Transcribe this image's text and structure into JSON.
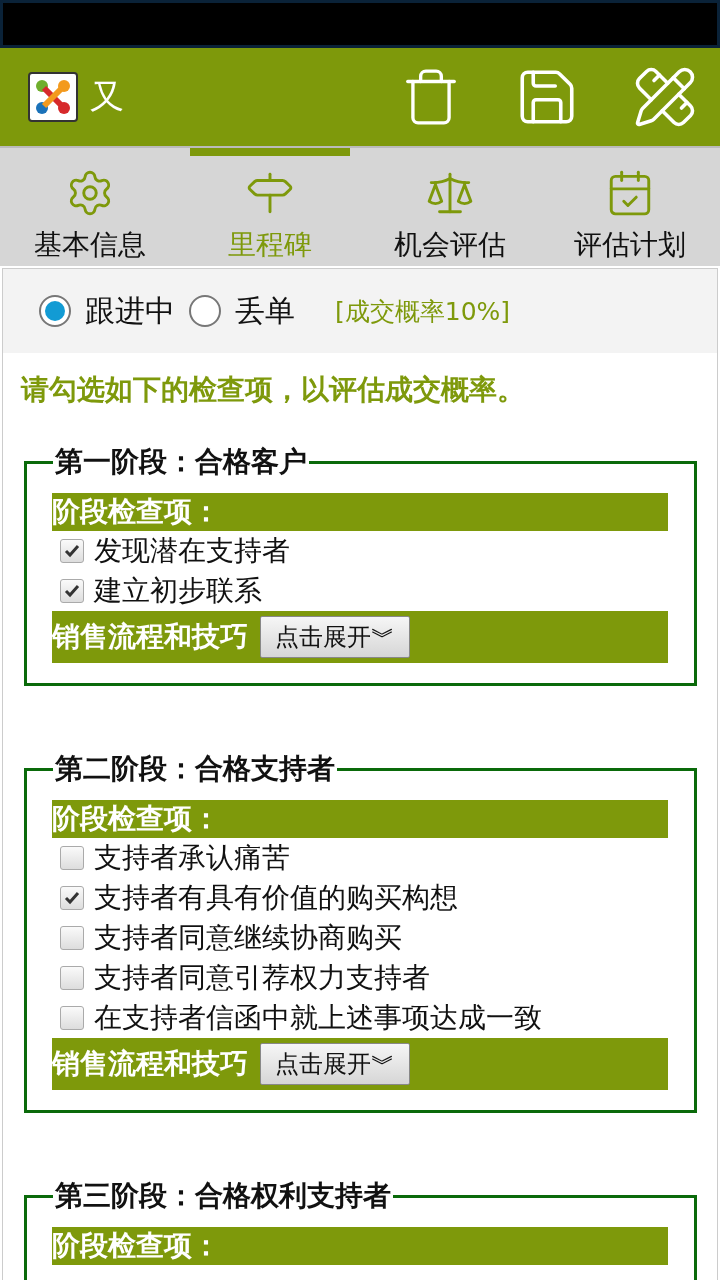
{
  "app_bar": {
    "title": "又"
  },
  "tabs": [
    {
      "label": "基本信息",
      "selected": false
    },
    {
      "label": "里程碑",
      "selected": true
    },
    {
      "label": "机会评估",
      "selected": false
    },
    {
      "label": "评估计划",
      "selected": false
    }
  ],
  "status_options": [
    {
      "label": "跟进中",
      "selected": true
    },
    {
      "label": "丢单",
      "selected": false
    }
  ],
  "probability": "[成交概率10%]",
  "instruction": "请勾选如下的检查项，以评估成交概率。",
  "stages": [
    {
      "title": "第一阶段：合格客户",
      "checklist_label": "阶段检查项：",
      "items": [
        {
          "label": "发现潜在支持者",
          "checked": true
        },
        {
          "label": "建立初步联系",
          "checked": true
        }
      ],
      "tips_label": "销售流程和技巧",
      "expand_button": "点击展开︾"
    },
    {
      "title": "第二阶段：合格支持者",
      "checklist_label": "阶段检查项：",
      "items": [
        {
          "label": "支持者承认痛苦",
          "checked": false
        },
        {
          "label": "支持者有具有价值的购买构想",
          "checked": true
        },
        {
          "label": "支持者同意继续协商购买",
          "checked": false
        },
        {
          "label": "支持者同意引荐权力支持者",
          "checked": false
        },
        {
          "label": "在支持者信函中就上述事项达成一致",
          "checked": false
        }
      ],
      "tips_label": "销售流程和技巧",
      "expand_button": "点击展开︾"
    },
    {
      "title": "第三阶段：合格权利支持者",
      "checklist_label": "阶段检查项："
    }
  ]
}
